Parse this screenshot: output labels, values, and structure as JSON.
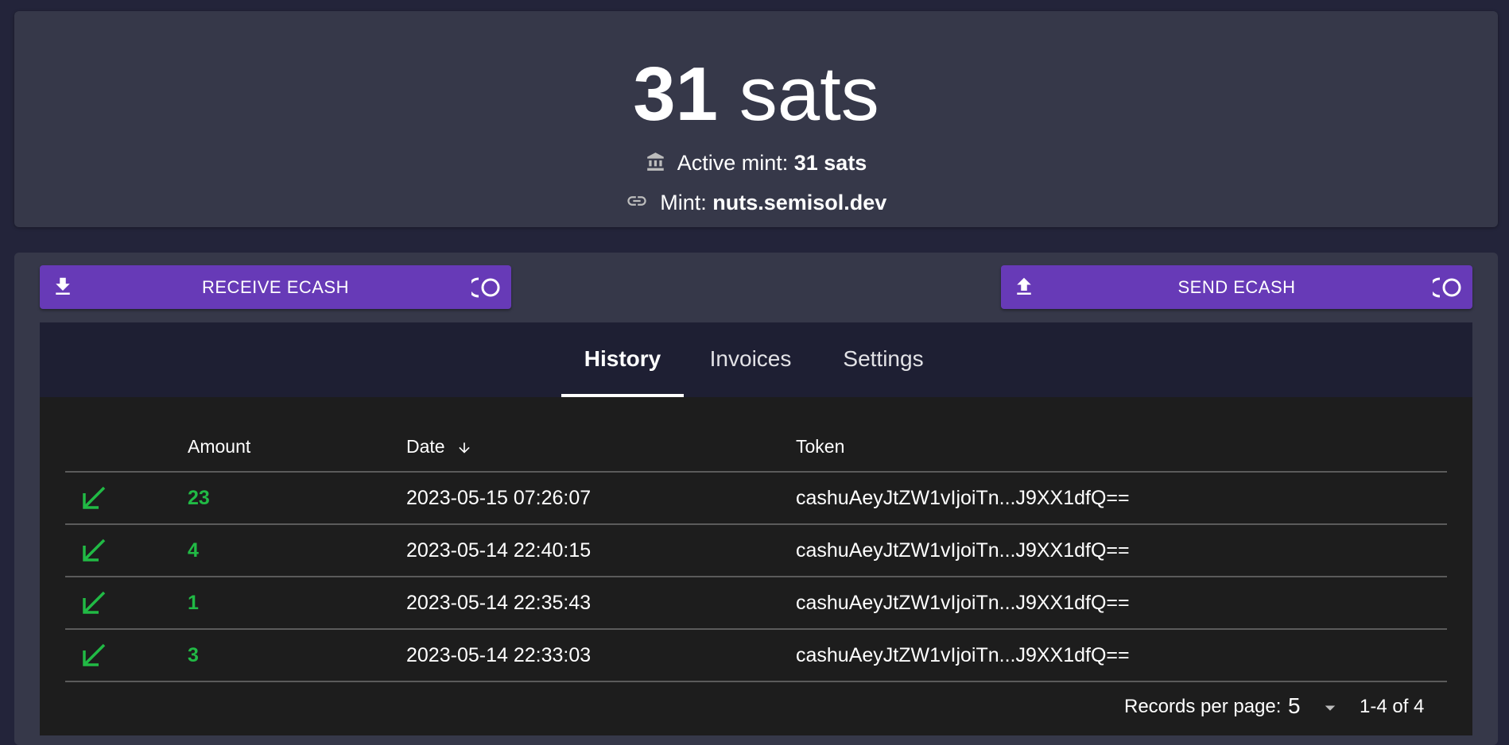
{
  "balance": {
    "amount": "31",
    "unit": "sats",
    "active_mint_label": "Active mint:",
    "active_mint_value": "31 sats",
    "mint_label": "Mint:",
    "mint_url": "nuts.semisol.dev"
  },
  "actions": {
    "receive_label": "RECEIVE ECASH",
    "send_label": "SEND ECASH"
  },
  "tabs": [
    {
      "label": "History",
      "active": true
    },
    {
      "label": "Invoices",
      "active": false
    },
    {
      "label": "Settings",
      "active": false
    }
  ],
  "history_table": {
    "columns": [
      "Amount",
      "Date",
      "Token"
    ],
    "sort_column": "Date",
    "rows": [
      {
        "amount": "23",
        "date": "2023-05-15 07:26:07",
        "token": "cashuAeyJtZW1vIjoiTn...J9XX1dfQ=="
      },
      {
        "amount": "4",
        "date": "2023-05-14 22:40:15",
        "token": "cashuAeyJtZW1vIjoiTn...J9XX1dfQ=="
      },
      {
        "amount": "1",
        "date": "2023-05-14 22:35:43",
        "token": "cashuAeyJtZW1vIjoiTn...J9XX1dfQ=="
      },
      {
        "amount": "3",
        "date": "2023-05-14 22:33:03",
        "token": "cashuAeyJtZW1vIjoiTn...J9XX1dfQ=="
      }
    ]
  },
  "pagination": {
    "records_per_page_label": "Records per page:",
    "records_per_page": "5",
    "range": "1-4 of 4"
  },
  "colors": {
    "background": "#23243a",
    "card": "#363849",
    "accent": "#673ab7",
    "incoming": "#21ba45",
    "table_bg": "#1d1d1d",
    "tabs_bg": "#1e1f33"
  },
  "icons": {
    "active_mint": "bank-icon",
    "mint": "link-icon",
    "receive": "download-icon",
    "send": "upload-icon",
    "nfc": "nfc-icon",
    "incoming_row": "arrow-south-west-icon",
    "sort": "arrow-down-icon",
    "dropdown": "caret-down-icon"
  }
}
